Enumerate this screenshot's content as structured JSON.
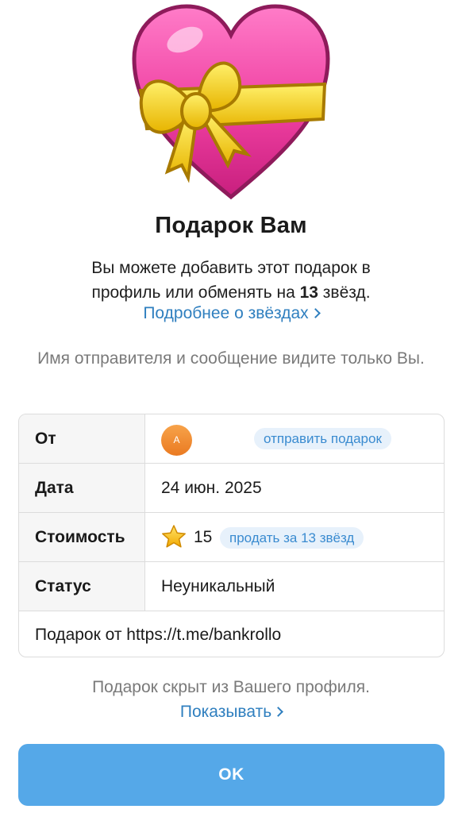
{
  "gift": {
    "image_icon": "heart-with-ribbon-icon",
    "title": "Подарок Вам",
    "desc_line1": "Вы можете добавить этот подарок в",
    "desc_line2_pre": "профиль или обменять на ",
    "desc_line2_bold": "13",
    "desc_line2_post": " звёзд.",
    "learn_more": "Подробнее о звёздах",
    "privacy_note": "Имя отправителя и сообщение видите только Вы."
  },
  "details": {
    "from_label": "От",
    "from_avatar_letter": "A",
    "send_gift": "отправить подарок",
    "date_label": "Дата",
    "date_value": "24 июн. 2025",
    "cost_label": "Стоимость",
    "cost_icon": "star-icon",
    "cost_value": "15",
    "sell_button": "продать за 13 звёзд",
    "status_label": "Статус",
    "status_value": "Неуникальный",
    "message": "Подарок от https://t.me/bankrollo"
  },
  "footer": {
    "hidden_text": "Подарок скрыт из Вашего профиля.",
    "show_link": "Показывать",
    "ok_button": "OK"
  },
  "colors": {
    "accent": "#55a8e8",
    "link": "#2f7fbf",
    "pill_bg": "#e7f1fb",
    "heart": "#ef3fa1",
    "ribbon": "#f6d21b"
  }
}
